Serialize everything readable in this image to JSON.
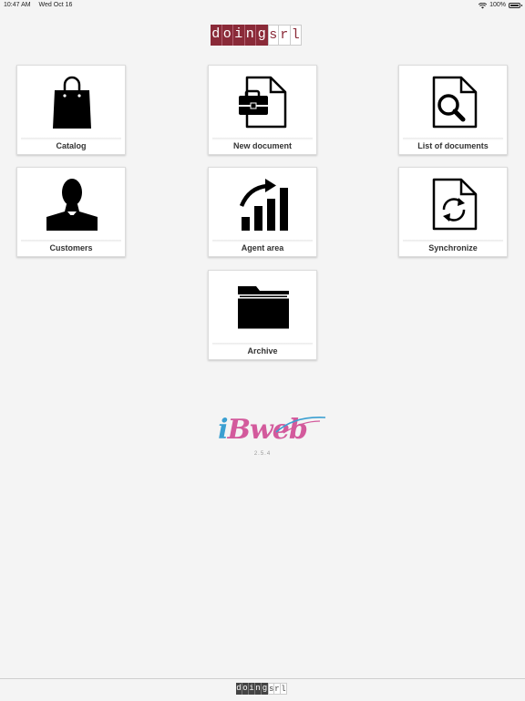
{
  "status_bar": {
    "time": "10:47 AM",
    "date": "Wed Oct 16",
    "battery": "100%",
    "battery_level": 1.0
  },
  "header": {
    "brand_letters": [
      "d",
      "o",
      "i",
      "n",
      "g",
      "s",
      "r",
      "l"
    ]
  },
  "menu": {
    "tiles": [
      {
        "label": "Catalog",
        "icon": "shopping-bag-icon"
      },
      {
        "label": "New document",
        "icon": "new-document-icon"
      },
      {
        "label": "List of documents",
        "icon": "search-document-icon"
      },
      {
        "label": "Customers",
        "icon": "person-icon"
      },
      {
        "label": "Agent area",
        "icon": "bar-chart-icon"
      },
      {
        "label": "Synchronize",
        "icon": "sync-document-icon"
      },
      {
        "label": "Archive",
        "icon": "folder-icon"
      }
    ]
  },
  "product": {
    "logo_text_i": "i",
    "logo_text_rest": "Bweb",
    "version": "2.5.4"
  },
  "footer": {
    "brand_letters": [
      "d",
      "o",
      "i",
      "n",
      "g",
      "s",
      "r",
      "l"
    ]
  },
  "colors": {
    "background": "#f4f4f4",
    "brand_dark": "#8a2a38",
    "logo_blue": "#3a9fd1",
    "logo_pink": "#d35a9c"
  }
}
